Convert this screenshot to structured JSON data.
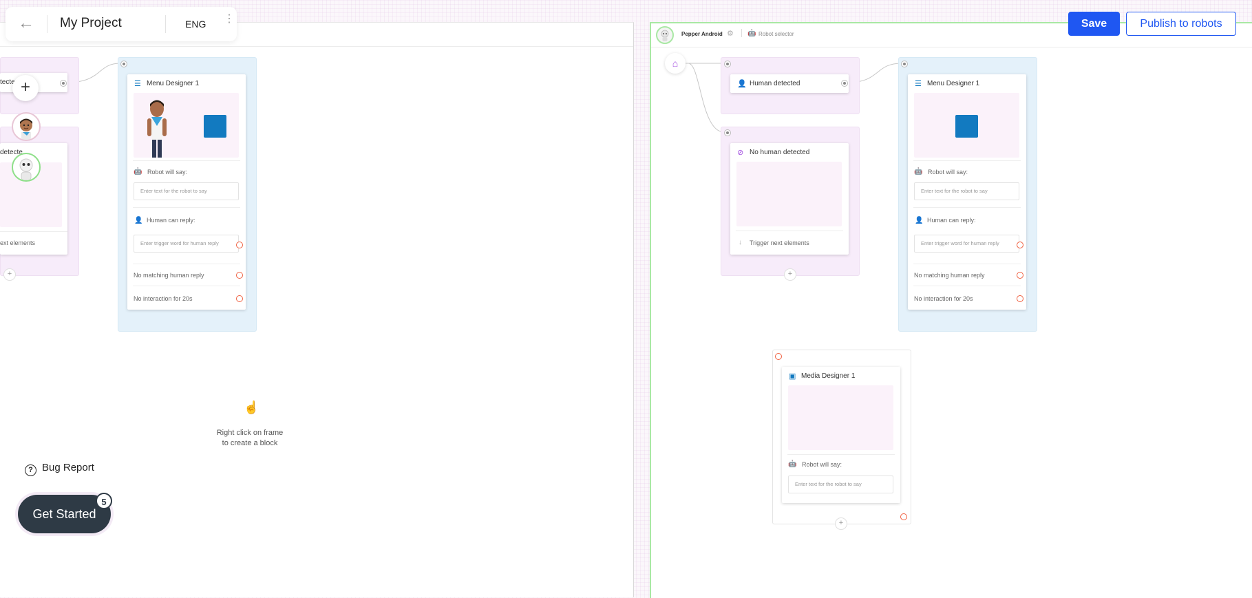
{
  "header": {
    "back_icon": "arrow-left-icon",
    "project_title": "My Project",
    "language": "ENG",
    "more_icon": "kebab-menu-icon"
  },
  "actions": {
    "save_label": "Save",
    "publish_label": "Publish to robots"
  },
  "left_frame": {
    "tools": {
      "add_icon": "+",
      "avatar_human": "human-avatar",
      "avatar_robot": "robot-avatar"
    },
    "partial_block_top": {
      "title": "Human detected",
      "visible_text": "tecte"
    },
    "partial_block_bottom": {
      "title": "No human detected",
      "visible_text": "detecte",
      "footer": "ext elements"
    },
    "menu_card": {
      "title": "Menu Designer 1",
      "robot_say_label": "Robot will say:",
      "robot_say_placeholder": "Enter text for the robot to say",
      "human_reply_label": "Human can reply:",
      "human_reply_placeholder": "Enter trigger word for human reply",
      "no_match": "No matching human reply",
      "no_interaction": "No interaction for 20s"
    },
    "hint": {
      "icon": "pointing-hand-icon",
      "line1": "Right click on frame",
      "line2": "to create a block"
    }
  },
  "right_frame": {
    "robot_name": "Pepper Android",
    "robot_selector": "Robot selector",
    "human_detected_card": {
      "title": "Human detected"
    },
    "no_human_card": {
      "title": "No human detected",
      "footer": "Trigger next elements"
    },
    "menu_card": {
      "title": "Menu Designer 1",
      "robot_say_label": "Robot will say:",
      "robot_say_placeholder": "Enter text for the robot to say",
      "human_reply_label": "Human can reply:",
      "human_reply_placeholder": "Enter trigger word for human reply",
      "no_match": "No matching human reply",
      "no_interaction": "No interaction for 20s"
    },
    "media_card": {
      "title": "Media Designer 1",
      "robot_say_label": "Robot will say:",
      "robot_say_placeholder": "Enter text for the robot to say"
    }
  },
  "help": {
    "bug_report": "Bug Report",
    "get_started": "Get Started",
    "get_started_count": "5"
  },
  "colors": {
    "primary": "#1f57f2",
    "menu_accent": "#127ac0",
    "human_accent": "#a34fe0",
    "alert_port": "#f06040",
    "active_frame": "#a9e8a4"
  }
}
